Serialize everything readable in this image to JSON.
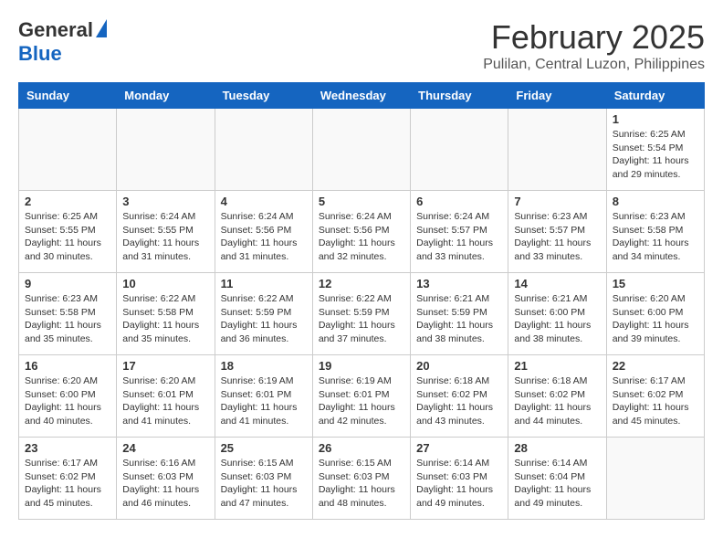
{
  "logo": {
    "general": "General",
    "blue": "Blue"
  },
  "title": "February 2025",
  "location": "Pulilan, Central Luzon, Philippines",
  "days_of_week": [
    "Sunday",
    "Monday",
    "Tuesday",
    "Wednesday",
    "Thursday",
    "Friday",
    "Saturday"
  ],
  "weeks": [
    [
      {
        "day": "",
        "info": ""
      },
      {
        "day": "",
        "info": ""
      },
      {
        "day": "",
        "info": ""
      },
      {
        "day": "",
        "info": ""
      },
      {
        "day": "",
        "info": ""
      },
      {
        "day": "",
        "info": ""
      },
      {
        "day": "1",
        "info": "Sunrise: 6:25 AM\nSunset: 5:54 PM\nDaylight: 11 hours and 29 minutes."
      }
    ],
    [
      {
        "day": "2",
        "info": "Sunrise: 6:25 AM\nSunset: 5:55 PM\nDaylight: 11 hours and 30 minutes."
      },
      {
        "day": "3",
        "info": "Sunrise: 6:24 AM\nSunset: 5:55 PM\nDaylight: 11 hours and 31 minutes."
      },
      {
        "day": "4",
        "info": "Sunrise: 6:24 AM\nSunset: 5:56 PM\nDaylight: 11 hours and 31 minutes."
      },
      {
        "day": "5",
        "info": "Sunrise: 6:24 AM\nSunset: 5:56 PM\nDaylight: 11 hours and 32 minutes."
      },
      {
        "day": "6",
        "info": "Sunrise: 6:24 AM\nSunset: 5:57 PM\nDaylight: 11 hours and 33 minutes."
      },
      {
        "day": "7",
        "info": "Sunrise: 6:23 AM\nSunset: 5:57 PM\nDaylight: 11 hours and 33 minutes."
      },
      {
        "day": "8",
        "info": "Sunrise: 6:23 AM\nSunset: 5:58 PM\nDaylight: 11 hours and 34 minutes."
      }
    ],
    [
      {
        "day": "9",
        "info": "Sunrise: 6:23 AM\nSunset: 5:58 PM\nDaylight: 11 hours and 35 minutes."
      },
      {
        "day": "10",
        "info": "Sunrise: 6:22 AM\nSunset: 5:58 PM\nDaylight: 11 hours and 35 minutes."
      },
      {
        "day": "11",
        "info": "Sunrise: 6:22 AM\nSunset: 5:59 PM\nDaylight: 11 hours and 36 minutes."
      },
      {
        "day": "12",
        "info": "Sunrise: 6:22 AM\nSunset: 5:59 PM\nDaylight: 11 hours and 37 minutes."
      },
      {
        "day": "13",
        "info": "Sunrise: 6:21 AM\nSunset: 5:59 PM\nDaylight: 11 hours and 38 minutes."
      },
      {
        "day": "14",
        "info": "Sunrise: 6:21 AM\nSunset: 6:00 PM\nDaylight: 11 hours and 38 minutes."
      },
      {
        "day": "15",
        "info": "Sunrise: 6:20 AM\nSunset: 6:00 PM\nDaylight: 11 hours and 39 minutes."
      }
    ],
    [
      {
        "day": "16",
        "info": "Sunrise: 6:20 AM\nSunset: 6:00 PM\nDaylight: 11 hours and 40 minutes."
      },
      {
        "day": "17",
        "info": "Sunrise: 6:20 AM\nSunset: 6:01 PM\nDaylight: 11 hours and 41 minutes."
      },
      {
        "day": "18",
        "info": "Sunrise: 6:19 AM\nSunset: 6:01 PM\nDaylight: 11 hours and 41 minutes."
      },
      {
        "day": "19",
        "info": "Sunrise: 6:19 AM\nSunset: 6:01 PM\nDaylight: 11 hours and 42 minutes."
      },
      {
        "day": "20",
        "info": "Sunrise: 6:18 AM\nSunset: 6:02 PM\nDaylight: 11 hours and 43 minutes."
      },
      {
        "day": "21",
        "info": "Sunrise: 6:18 AM\nSunset: 6:02 PM\nDaylight: 11 hours and 44 minutes."
      },
      {
        "day": "22",
        "info": "Sunrise: 6:17 AM\nSunset: 6:02 PM\nDaylight: 11 hours and 45 minutes."
      }
    ],
    [
      {
        "day": "23",
        "info": "Sunrise: 6:17 AM\nSunset: 6:02 PM\nDaylight: 11 hours and 45 minutes."
      },
      {
        "day": "24",
        "info": "Sunrise: 6:16 AM\nSunset: 6:03 PM\nDaylight: 11 hours and 46 minutes."
      },
      {
        "day": "25",
        "info": "Sunrise: 6:15 AM\nSunset: 6:03 PM\nDaylight: 11 hours and 47 minutes."
      },
      {
        "day": "26",
        "info": "Sunrise: 6:15 AM\nSunset: 6:03 PM\nDaylight: 11 hours and 48 minutes."
      },
      {
        "day": "27",
        "info": "Sunrise: 6:14 AM\nSunset: 6:03 PM\nDaylight: 11 hours and 49 minutes."
      },
      {
        "day": "28",
        "info": "Sunrise: 6:14 AM\nSunset: 6:04 PM\nDaylight: 11 hours and 49 minutes."
      },
      {
        "day": "",
        "info": ""
      }
    ]
  ]
}
